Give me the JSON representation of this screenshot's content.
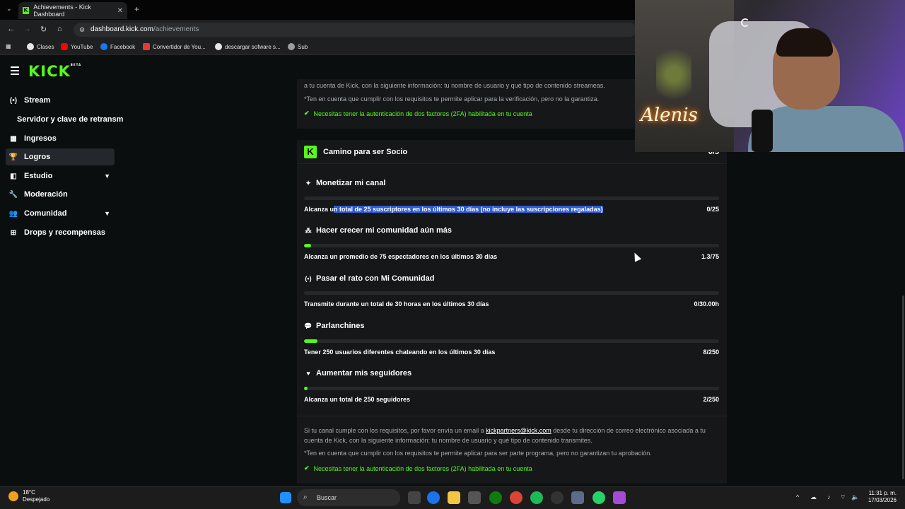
{
  "browser": {
    "tab_title": "Achievements - Kick Dashboard",
    "url_host": "dashboard.kick.com",
    "url_path": "/achievements",
    "bookmarks": [
      "Clases",
      "YouTube",
      "Facebook",
      "Convertidor de You...",
      "descargar sofware s...",
      "Sub"
    ]
  },
  "header": {
    "logo": "KICK",
    "logo_badge": "BETA"
  },
  "sidebar": {
    "items": [
      {
        "label": "Stream",
        "icon": "broadcast-icon"
      },
      {
        "label": "Servidor y clave de retransm",
        "icon": ""
      },
      {
        "label": "Ingresos",
        "icon": "chart-icon"
      },
      {
        "label": "Logros",
        "icon": "trophy-icon"
      },
      {
        "label": "Estudio",
        "icon": "studio-icon"
      },
      {
        "label": "Moderación",
        "icon": "wrench-icon"
      },
      {
        "label": "Comunidad",
        "icon": "people-icon"
      },
      {
        "label": "Drops y recompensas",
        "icon": "drops-icon"
      }
    ]
  },
  "top_panel": {
    "cut_line": "a tu cuenta de Kick, con la siguiente información: tu nombre de usuario y qué tipo de contenido streameas.",
    "note": "*Ten en cuenta que cumplir con los requisitos te permite aplicar para la verificación, pero no la garantiza.",
    "check": "Necesitas tener la autenticación de dos factores (2FA) habilitada en tu cuenta"
  },
  "section": {
    "title": "Camino para ser Socio",
    "count": "0/5",
    "achievements": [
      {
        "title": "Monetizar mi canal",
        "desc_pre": "Alcanza u",
        "desc_hl": "n total de 25 suscriptores en los últimos 30 días (no incluye las suscripciones regaladas)",
        "value": "0/25",
        "progress": 0
      },
      {
        "title": "Hacer crecer mi comunidad aún más",
        "desc": "Alcanza un promedio de 75 espectadores en los últimos 30 días",
        "value": "1.3/75",
        "progress": 0.017
      },
      {
        "title": "Pasar el rato con Mi Comunidad",
        "desc": "Transmite durante un total de 30 horas en los últimos 30 días",
        "value": "0/30.00h",
        "progress": 0
      },
      {
        "title": "Parlanchines",
        "desc": "Tener 250 usuarios diferentes chateando en los últimos 30 días",
        "value": "8/250",
        "progress": 0.032
      },
      {
        "title": "Aumentar mis seguidores",
        "desc": "Alcanza un total de 250 seguidores",
        "value": "2/250",
        "progress": 0.008
      }
    ],
    "footer_pre": "Si tu canal cumple con los requisitos, por favor envía un email a ",
    "footer_email": "kickpartners@kick.com",
    "footer_post": " desde tu dirección de correo electrónico asociada a tu cuenta de Kick, con la siguiente información: tu nombre de usuario y qué tipo de contenido transmites.",
    "footer_note": "*Ten en cuenta que cumplir con los requisitos te permite aplicar para ser parte programa, pero no garantizan tu aprobación.",
    "footer_check": "Necesitas tener la autenticación de dos factores (2FA) habilitada en tu cuenta"
  },
  "webcam": {
    "neon_text": "Alenis"
  },
  "taskbar": {
    "weather_temp": "18°C",
    "weather_desc": "Despejado",
    "search_placeholder": "Buscar",
    "time": "11:31 p. m.",
    "date": "17/03/2026"
  },
  "colors": {
    "accent": "#53fc18",
    "panel": "#151718",
    "bg": "#0b0e0f",
    "highlight": "#2d5bd2"
  }
}
